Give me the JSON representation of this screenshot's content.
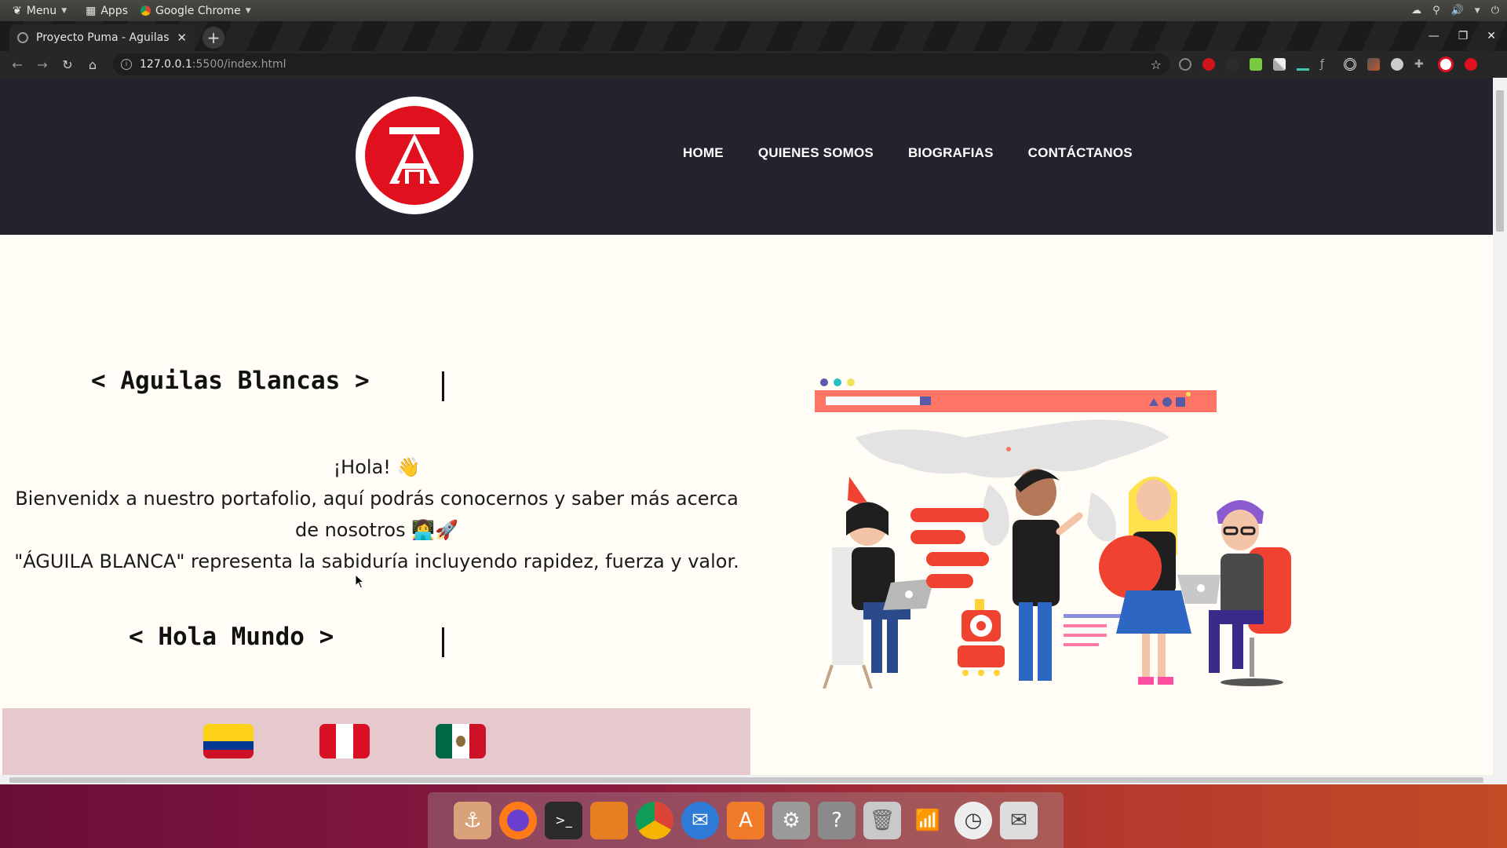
{
  "os_panel": {
    "menu_label": "Menu",
    "apps_label": "Apps",
    "active_app": "Google Chrome"
  },
  "browser": {
    "tab_title": "Proyecto Puma - Aguilas B",
    "url_host": "127.0.0.1",
    "url_path": ":5500/index.html"
  },
  "site": {
    "nav": [
      "HOME",
      "QUIENES SOMOS",
      "BIOGRAFIAS",
      "CONTÁCTANOS"
    ],
    "heading_1": "< Aguilas Blancas >",
    "greeting": "¡Hola! 👋",
    "welcome": "Bienvenidx a nuestro portafolio, aquí podrás conocernos y saber más acerca de nosotros 👩‍💻🚀",
    "motto": "\"ÁGUILA BLANCA\" representa la sabiduría incluyendo rapidez, fuerza y valor.",
    "heading_2": "< Hola Mundo >",
    "flags": [
      "colombia-flag",
      "peru-flag",
      "mexico-flag"
    ]
  },
  "colors": {
    "header_bg": "#22232d",
    "accent_red": "#e0101f",
    "page_bg": "#fffdf6",
    "flags_bar_bg": "#e6c9cd"
  }
}
